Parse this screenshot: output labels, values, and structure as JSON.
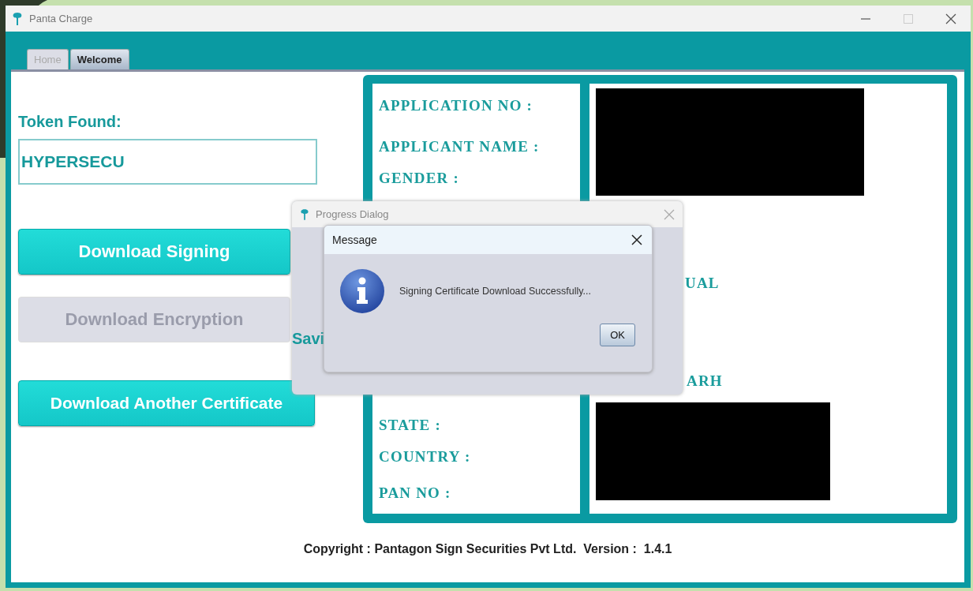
{
  "window": {
    "title": "Panta Charge"
  },
  "tabs": [
    {
      "label": "Home",
      "selected": false
    },
    {
      "label": "Welcome",
      "selected": true
    }
  ],
  "token": {
    "label": "Token Found:",
    "value": "HYPERSECU"
  },
  "buttons": [
    {
      "label": "Download Signing",
      "disabled": false
    },
    {
      "label": "Download Encryption",
      "disabled": true
    },
    {
      "label": "Download Another Certificate",
      "disabled": false
    }
  ],
  "details": {
    "labels_top": [
      "APPLICATION NO :",
      "APPLICANT NAME :",
      "GENDER :"
    ],
    "labels_bottom": [
      "STATE :",
      "COUNTRY :",
      "PAN NO :"
    ],
    "visible_values": [
      "UAL",
      "ARH"
    ]
  },
  "footer": "Copyright : Pantagon Sign Securities Pvt Ltd.  Version :  1.4.1",
  "progress_dialog": {
    "title": "Progress Dialog",
    "status": "Savi"
  },
  "message_dialog": {
    "title": "Message",
    "text": "Signing Certificate Download Successfully...",
    "ok": "OK"
  }
}
